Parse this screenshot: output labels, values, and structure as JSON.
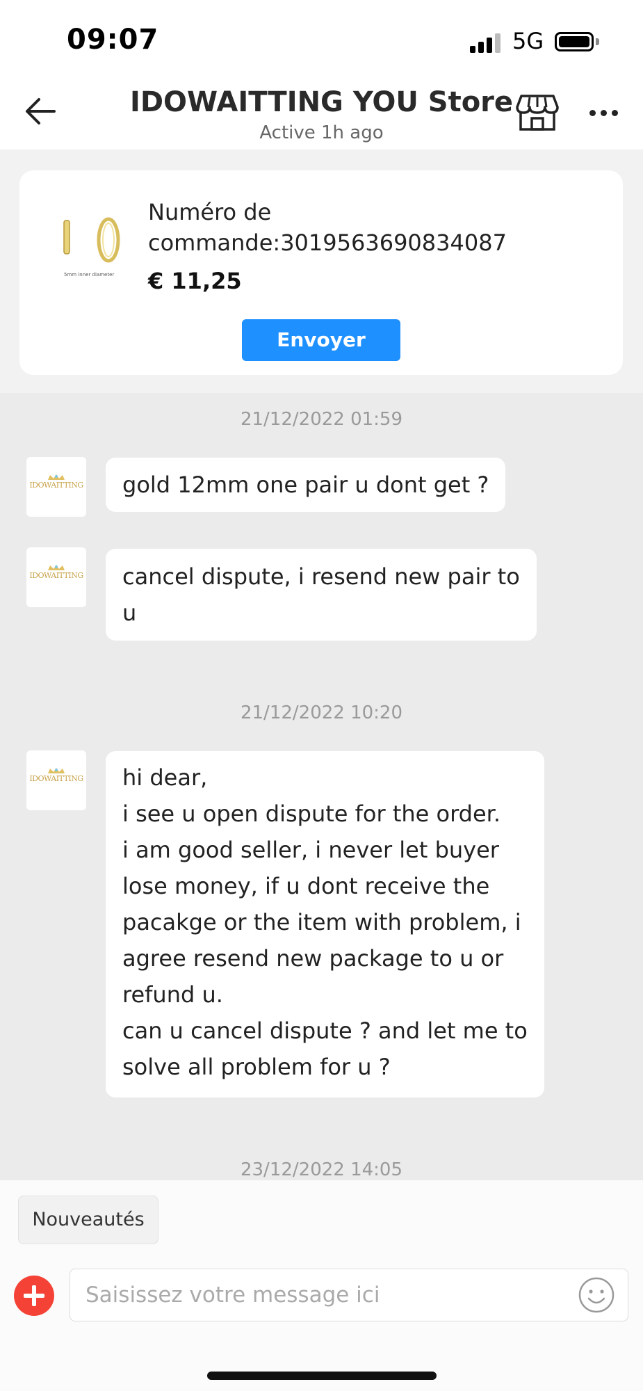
{
  "status_bar": {
    "time": "09:07",
    "network": "5G"
  },
  "header": {
    "title": "IDOWAITTING YOU Store",
    "subtitle": "Active 1h ago",
    "icons": [
      "back-arrow-icon",
      "store-icon",
      "more-icon"
    ]
  },
  "order": {
    "label_line1": "Numéro de",
    "label_line2": "commande:3019563690834087",
    "price": "€ 11,25",
    "send_label": "Envoyer",
    "thumb_caption": "5mm inner diameter"
  },
  "avatar_logo_text": "IDOWAITTING",
  "messages": [
    {
      "timestamp": "21/12/2022 01:59"
    },
    {
      "lines": [
        "gold 12mm one pair u dont get ?"
      ]
    },
    {
      "lines": [
        "cancel dispute, i resend new pair to",
        "u"
      ]
    },
    {
      "timestamp": "21/12/2022 10:20"
    },
    {
      "lines": [
        "hi dear,",
        "i see u open dispute for the order.",
        "i am good seller, i never let buyer",
        "lose money, if u dont receive the",
        "pacakge or the item with problem, i",
        "agree resend new package to u or",
        "refund u.",
        "can u cancel dispute ? and let me to",
        "solve all problem for u ?"
      ]
    },
    {
      "timestamp": "23/12/2022 14:05"
    }
  ],
  "bottom": {
    "chip_label": "Nouveautés",
    "input_placeholder": "Saisissez votre message ici"
  },
  "colors": {
    "accent": "#1e90ff",
    "add_button": "#f44336",
    "chat_bg": "#ebebeb"
  }
}
